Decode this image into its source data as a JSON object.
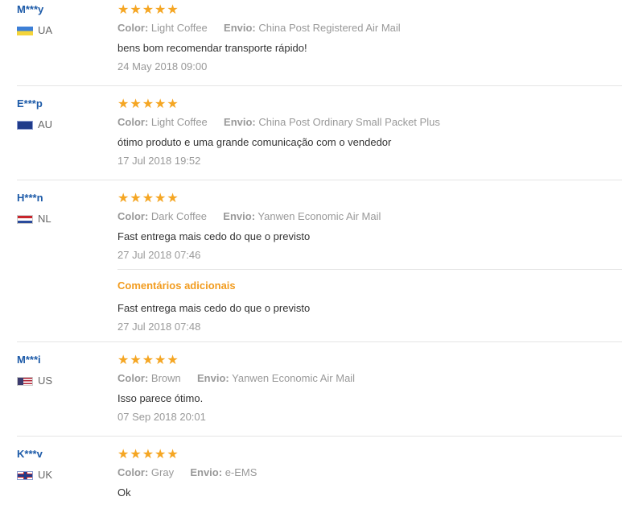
{
  "labels": {
    "color": "Color:",
    "shipping": "Envio:"
  },
  "reviews": [
    {
      "user": "M***y",
      "country": "UA",
      "stars": [
        "★",
        "★",
        "★",
        "★",
        "★"
      ],
      "color": "Light Coffee",
      "shipping": "China Post Registered Air Mail",
      "comment": "bens bom recomendar transporte rápido!",
      "date": "24 May 2018 09:00"
    },
    {
      "user": "E***p",
      "country": "AU",
      "stars": [
        "★",
        "★",
        "★",
        "★",
        "★"
      ],
      "color": "Light Coffee",
      "shipping": "China Post Ordinary Small Packet Plus",
      "comment": "ótimo produto e uma grande comunicação com o vendedor",
      "date": "17 Jul 2018 19:52"
    },
    {
      "user": "H***n",
      "country": "NL",
      "stars": [
        "★",
        "★",
        "★",
        "★",
        "★"
      ],
      "color": "Dark Coffee",
      "shipping": "Yanwen Economic Air Mail",
      "comment": "Fast entrega mais cedo do que o previsto",
      "date": "27 Jul 2018 07:46",
      "additional": {
        "title": "Comentários adicionais",
        "comment": "Fast entrega mais cedo do que o previsto",
        "date": "27 Jul 2018 07:48"
      }
    },
    {
      "user": "M***i",
      "country": "US",
      "stars": [
        "★",
        "★",
        "★",
        "★",
        "★"
      ],
      "color": "Brown",
      "shipping": "Yanwen Economic Air Mail",
      "comment": "Isso parece ótimo.",
      "date": "07 Sep 2018 20:01"
    },
    {
      "user": "K***v",
      "country": "UK",
      "stars": [
        "★",
        "★",
        "★",
        "★",
        "★"
      ],
      "color": "Gray",
      "shipping": "e-EMS",
      "comment": "Ok",
      "date": ""
    }
  ]
}
